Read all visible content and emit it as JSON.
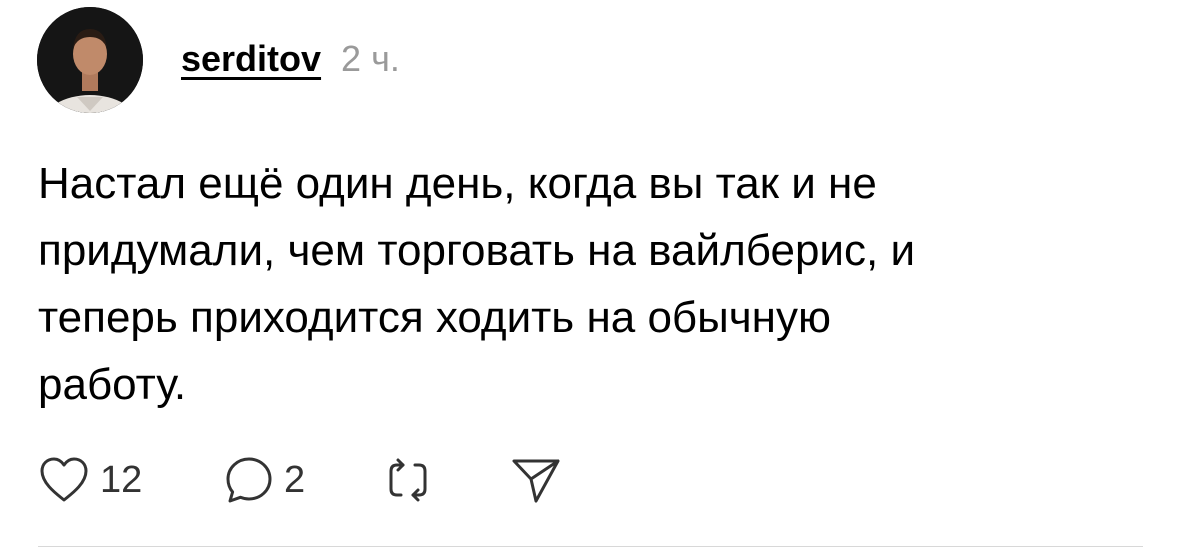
{
  "post": {
    "author": {
      "username": "serditov",
      "avatar_icon": "user-avatar"
    },
    "timestamp": "2 ч.",
    "text": "Настал ещё один день, когда вы так и не\nпридумали, чем торговать на вайлберис, и\nтеперь приходится ходить на обычную\nработу.",
    "actions": {
      "likes": {
        "icon": "heart-icon",
        "count": "12"
      },
      "comments": {
        "icon": "comment-icon",
        "count": "2"
      },
      "repost": {
        "icon": "repost-icon"
      },
      "share": {
        "icon": "send-icon"
      }
    }
  },
  "colors": {
    "text": "#000000",
    "timestamp": "#9a9a9a",
    "icon": "#333333",
    "divider": "#d8d8d8"
  }
}
